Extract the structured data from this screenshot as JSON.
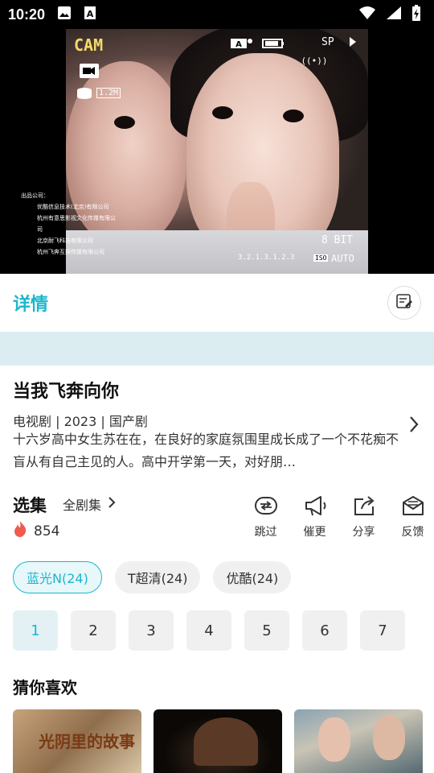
{
  "status_bar": {
    "time": "10:20",
    "left_icons": [
      "image-icon",
      "a-box-icon"
    ],
    "right_icons": [
      "wifi-icon",
      "signal-icon",
      "battery-charging-icon"
    ]
  },
  "video": {
    "cam_label": "CAM",
    "sp_label": "SP",
    "size_label": "1.2M",
    "bit_label": "8 BIT",
    "auto_label": "AUTO",
    "iso_label": "ISO",
    "version_label": "3.2.1.3.1.2.3",
    "credits": [
      "出品公司：",
      "优酷信息技术(北京)有限公司",
      "杭州有意思影视文化传媒有限公司",
      "北京耐飞科技有限公司",
      "杭州飞奔互娱传媒有限公司"
    ]
  },
  "detail": {
    "tab_title": "详情"
  },
  "show": {
    "title": "当我飞奔向你",
    "meta": "电视剧 | 2023 | 国产剧",
    "description": "十六岁高中女生苏在在，在良好的家庭氛围里成长成了一个不花痴不盲从有自己主见的人。高中开学第一天，对好朋…"
  },
  "episodes": {
    "heading": "选集",
    "all_label": "全剧集",
    "hot_count": "854",
    "actions": [
      {
        "label": "跳过",
        "icon": "skip-icon"
      },
      {
        "label": "催更",
        "icon": "megaphone-icon"
      },
      {
        "label": "分享",
        "icon": "share-icon"
      },
      {
        "label": "反馈",
        "icon": "feedback-icon"
      }
    ],
    "sources": [
      "蓝光N(24)",
      "T超清(24)",
      "优酷(24)"
    ],
    "numbers": [
      "1",
      "2",
      "3",
      "4",
      "5",
      "6",
      "7"
    ]
  },
  "recommend": {
    "heading": "猜你喜欢",
    "thumb1_text": "光阴里的故事"
  },
  "colors": {
    "accent": "#1bb7cc",
    "ad_strip": "#dcedf2",
    "hot": "#f05a4f"
  }
}
